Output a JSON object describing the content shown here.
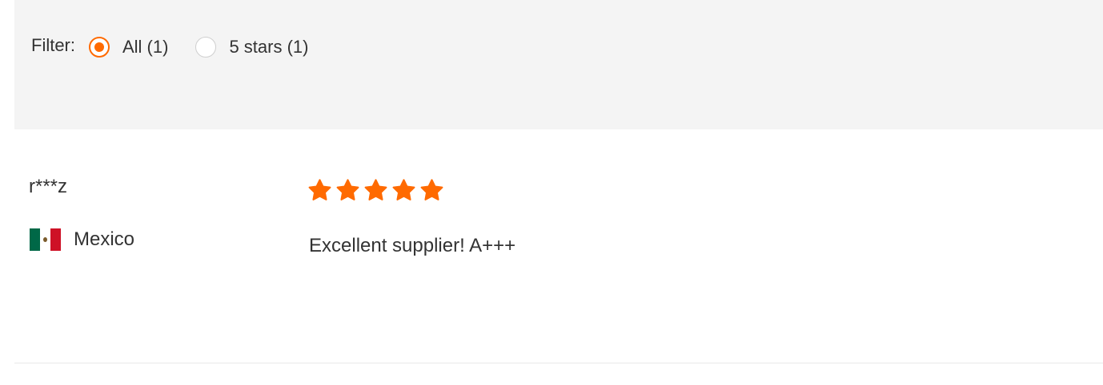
{
  "filter": {
    "label": "Filter:",
    "options": [
      {
        "label": "All (1)",
        "selected": true
      },
      {
        "label": "5 stars (1)",
        "selected": false
      }
    ]
  },
  "review": {
    "reviewer": "r***z",
    "country": "Mexico",
    "flag_icon": "mexico-flag-icon",
    "rating": 5,
    "rating_max": 5,
    "star_icon": "star-icon",
    "text": "Excellent supplier! A+++"
  },
  "colors": {
    "accent": "#ff6a00",
    "filter_background": "#f4f4f4",
    "text": "#333333"
  }
}
